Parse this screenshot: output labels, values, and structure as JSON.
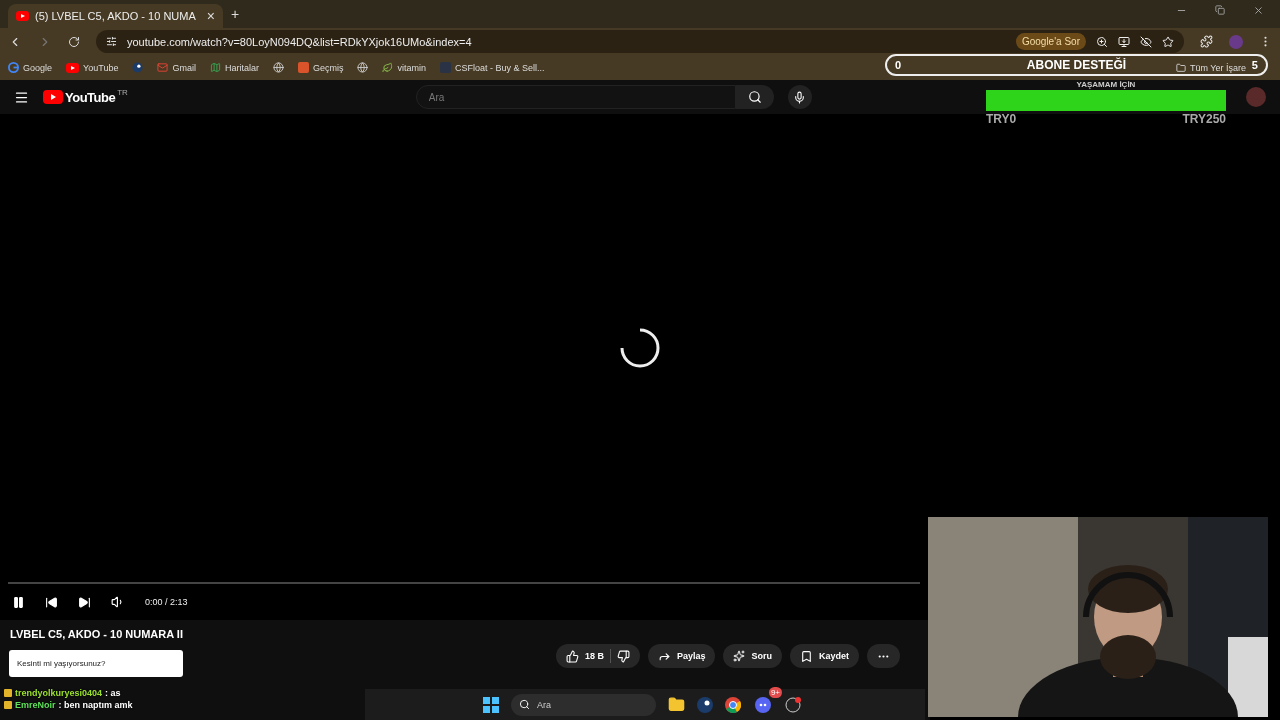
{
  "browser": {
    "tab": {
      "title": "(5) LVBEL C5, AKDO - 10 NUMA",
      "close": "×"
    },
    "new_tab": "+",
    "address": "youtube.com/watch?v=80LoyN094DQ&list=RDkYXjok16UMo&index=4",
    "ask_google": "Google'a Sor",
    "bookmarks": [
      {
        "kind": "google",
        "label": "Google"
      },
      {
        "kind": "youtube",
        "label": "YouTube"
      },
      {
        "kind": "steam"
      },
      {
        "kind": "gmail",
        "label": "Gmail"
      },
      {
        "kind": "maps",
        "label": "Haritalar"
      },
      {
        "kind": "globe"
      },
      {
        "kind": "history",
        "label": "Geçmiş"
      },
      {
        "kind": "globe"
      },
      {
        "kind": "leaf",
        "label": "vitamin"
      },
      {
        "kind": "csfloat",
        "label": "CSFloat - Buy & Sell..."
      }
    ],
    "all_bookmarks": "Tüm Yer İşare"
  },
  "youtube": {
    "logo": "YouTube",
    "country": "TR",
    "search": {
      "placeholder": "Ara"
    },
    "player": {
      "playing": true,
      "time": "0:00 / 2:13"
    },
    "video_title": "LVBEL C5, AKDO - 10 NUMARA II",
    "popup": "Kesinti mi yaşıyorsunuz?",
    "actions": [
      {
        "kind": "like",
        "label": "18 B"
      },
      {
        "kind": "share",
        "label": "Paylaş"
      },
      {
        "kind": "ask",
        "label": "Soru"
      },
      {
        "kind": "save",
        "label": "Kaydet"
      },
      {
        "kind": "more"
      }
    ]
  },
  "overlay": {
    "goal_title": "ABONE DESTEĞİ",
    "goal_start": "0",
    "goal_end": "5",
    "donation": {
      "caption": "YAŞAMAM İÇİN",
      "level": 1,
      "min": "TRY0",
      "max": "TRY250"
    }
  },
  "chat": [
    {
      "user": "trendyolkuryesi0404",
      "text": ": as",
      "color": "#9be02c"
    },
    {
      "user": "EmreNoir",
      "text": ": ben naptım amk",
      "color": "#5ee05a"
    }
  ],
  "taskbar": {
    "search": {
      "placeholder": "Ara"
    },
    "discord_badge": "9+"
  }
}
